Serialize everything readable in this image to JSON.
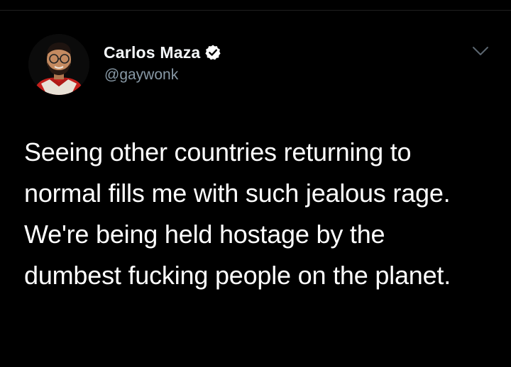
{
  "author": {
    "display_name": "Carlos Maza",
    "handle": "@gaywonk",
    "verified": true,
    "avatar_icon": "profile-photo-icon",
    "verified_icon": "verified-badge-icon",
    "verified_color": "#1da1f2"
  },
  "menu": {
    "icon": "chevron-down-icon"
  },
  "tweet": {
    "text": "Seeing other countries returning to normal fills me with such jealous rage. We're being held hostage by the dumbest fucking people on the planet."
  },
  "colors": {
    "background": "#000000",
    "text_primary": "#ffffff",
    "text_secondary": "#8899a6"
  }
}
